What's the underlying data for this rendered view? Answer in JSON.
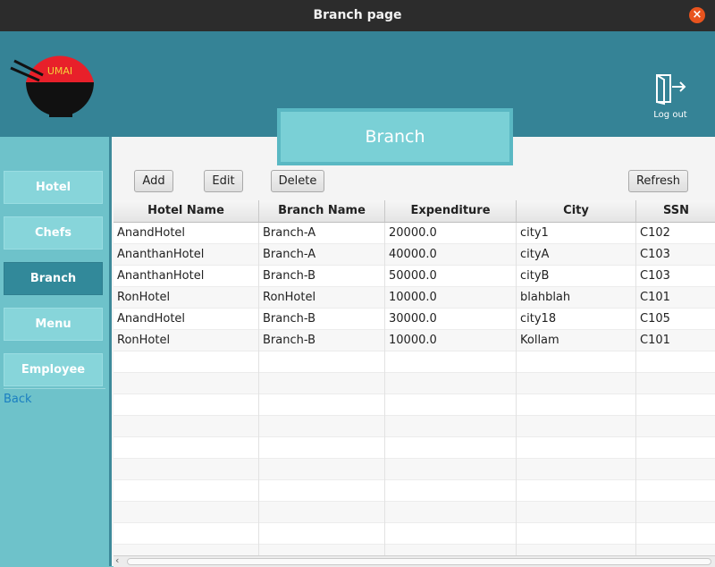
{
  "window": {
    "title": "Branch page"
  },
  "header": {
    "logo_text": "UMAI",
    "logout_label": "Log out",
    "page_tab": "Branch"
  },
  "sidebar": {
    "items": [
      {
        "label": "Hotel",
        "active": false
      },
      {
        "label": "Chefs",
        "active": false
      },
      {
        "label": "Branch",
        "active": true
      },
      {
        "label": "Menu",
        "active": false
      },
      {
        "label": "Employee",
        "active": false
      }
    ],
    "back_label": "Back"
  },
  "toolbar": {
    "add_label": "Add",
    "edit_label": "Edit",
    "delete_label": "Delete",
    "refresh_label": "Refresh"
  },
  "table": {
    "columns": [
      "Hotel Name",
      "Branch Name",
      "Expenditure",
      "City",
      "SSN"
    ],
    "rows": [
      [
        "AnandHotel",
        "Branch-A",
        "20000.0",
        "city1",
        "C102"
      ],
      [
        "AnanthanHotel",
        "Branch-A",
        "40000.0",
        "cityA",
        "C103"
      ],
      [
        "AnanthanHotel",
        "Branch-B",
        "50000.0",
        "cityB",
        "C103"
      ],
      [
        "RonHotel",
        "RonHotel",
        "10000.0",
        "blahblah",
        "C101"
      ],
      [
        "AnandHotel",
        "Branch-B",
        "30000.0",
        "city18",
        "C105"
      ],
      [
        "RonHotel",
        "Branch-B",
        "10000.0",
        "Kollam",
        "C101"
      ]
    ]
  },
  "colors": {
    "header": "#358396",
    "sidebar": "#6ec2ca",
    "active": "#32899a",
    "logo_red": "#e8202a"
  }
}
